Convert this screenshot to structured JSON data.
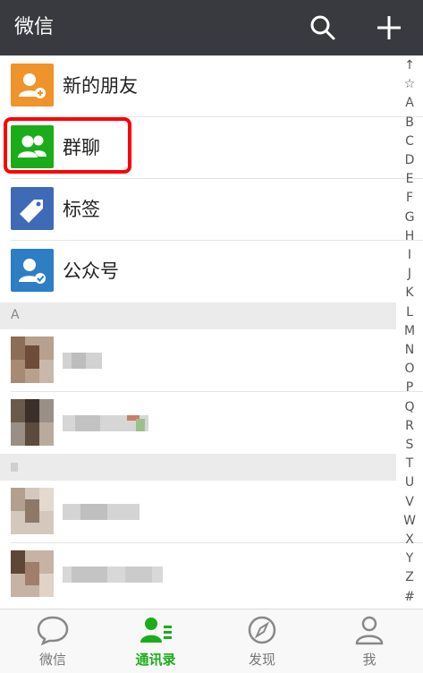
{
  "header": {
    "title": "微信",
    "icons": [
      "search-icon",
      "plus-icon"
    ]
  },
  "functions": [
    {
      "label": "新的朋友",
      "icon": "add-friend-icon",
      "color": "#f0932b"
    },
    {
      "label": "群聊",
      "icon": "group-chat-icon",
      "color": "#1aad19"
    },
    {
      "label": "标签",
      "icon": "tag-icon",
      "color": "#3f6ab6"
    },
    {
      "label": "公众号",
      "icon": "official-account-icon",
      "color": "#2d7ec5"
    }
  ],
  "sections": [
    "A"
  ],
  "index_bar": [
    "↑",
    "☆",
    "A",
    "B",
    "C",
    "D",
    "E",
    "F",
    "G",
    "H",
    "I",
    "J",
    "K",
    "L",
    "M",
    "N",
    "O",
    "P",
    "Q",
    "R",
    "S",
    "T",
    "U",
    "V",
    "W",
    "X",
    "Y",
    "Z",
    "#"
  ],
  "tabbar": {
    "tabs": [
      {
        "label": "微信",
        "icon": "chat-bubble-icon"
      },
      {
        "label": "通讯录",
        "icon": "contacts-icon",
        "active": true
      },
      {
        "label": "发现",
        "icon": "compass-icon"
      },
      {
        "label": "我",
        "icon": "person-icon"
      }
    ]
  },
  "colors": {
    "header_bg": "#393a3f",
    "accent": "#1aad19",
    "highlight": "#ff0000"
  }
}
